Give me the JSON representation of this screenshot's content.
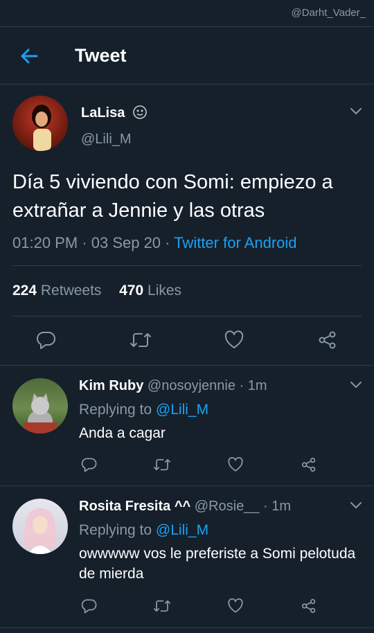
{
  "watermark": "@Darht_Vader_",
  "header": {
    "title": "Tweet"
  },
  "tweet": {
    "name": "LaLisa",
    "handle": "@Lili_M",
    "text": "Día 5 viviendo con Somi: empiezo a extrañar a Jennie y las otras",
    "time": "01:20 PM",
    "date": "03 Sep 20",
    "source": "Twitter for Android",
    "retweets": "224",
    "retweets_label": "Retweets",
    "likes": "470",
    "likes_label": "Likes"
  },
  "replies": [
    {
      "name": "Kim Ruby",
      "handle": "@nosoyjennie",
      "time": "1m",
      "replying_label": "Replying to",
      "replying_to": "@Lili_M",
      "text": "Anda a cagar"
    },
    {
      "name": "Rosita Fresita ^^",
      "handle": "@Rosie__",
      "time": "1m",
      "replying_label": "Replying to",
      "replying_to": "@Lili_M",
      "text": "owwwww vos le preferiste a Somi pelotuda de mierda"
    }
  ],
  "colors": {
    "background": "#15202b",
    "accent": "#1da1f2",
    "secondary_text": "#8899a6",
    "divider": "#2f3b47"
  },
  "icons": [
    "back-arrow-icon",
    "emoji-icon",
    "chevron-down-icon",
    "reply-icon",
    "retweet-icon",
    "like-icon",
    "share-icon"
  ]
}
